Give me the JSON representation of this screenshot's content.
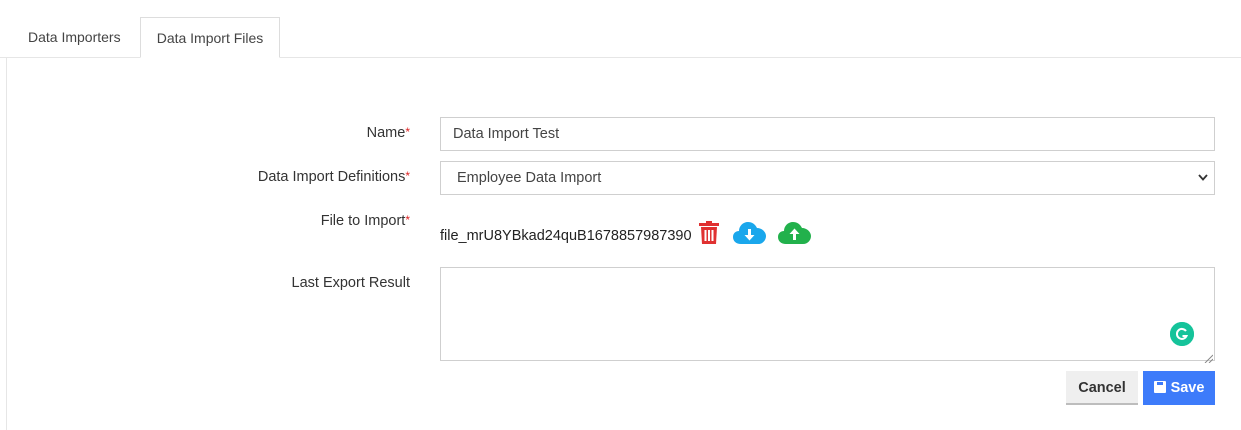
{
  "tabs": [
    {
      "label": "Data Importers",
      "active": false
    },
    {
      "label": "Data Import Files",
      "active": true
    }
  ],
  "form": {
    "name": {
      "label": "Name",
      "required_mark": "*",
      "value": "Data Import Test"
    },
    "definitions": {
      "label": "Data Import Definitions",
      "required_mark": "*",
      "selected": "Employee Data Import"
    },
    "file": {
      "label": "File to Import",
      "required_mark": "*",
      "filename": "file_mrU8YBkad24quB1678857987390",
      "icons": [
        "trash-icon",
        "cloud-download-icon",
        "cloud-upload-icon"
      ]
    },
    "last_export": {
      "label": "Last Export Result",
      "value": ""
    }
  },
  "buttons": {
    "cancel": "Cancel",
    "save": "Save"
  },
  "colors": {
    "required": "#dd2222",
    "delete": "#e03131",
    "download": "#1aa7ec",
    "upload": "#22b14c",
    "save": "#3d7bfa",
    "grammarly": "#15c39a"
  }
}
